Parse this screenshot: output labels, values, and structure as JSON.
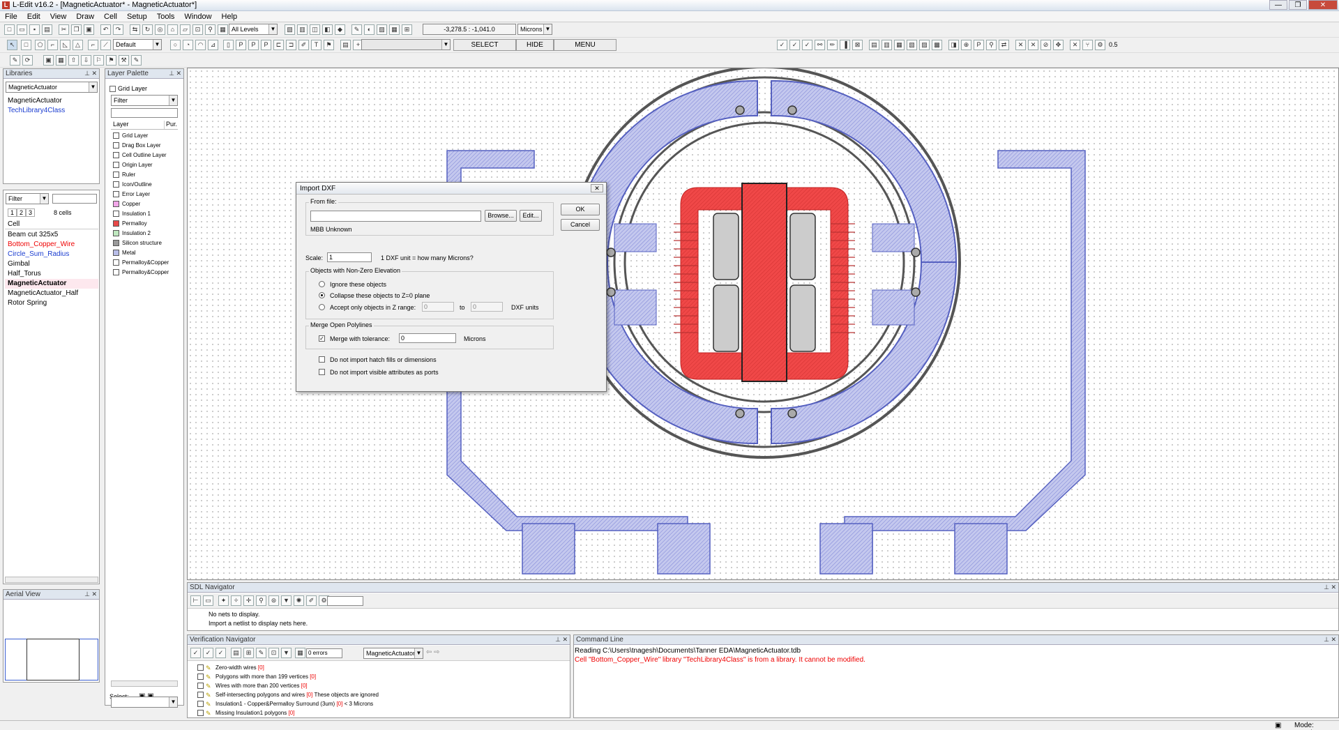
{
  "window": {
    "title": "L-Edit v16.2 - [MagneticActuator* - MagneticActuator*]",
    "buttons": [
      "—",
      "❐",
      "✕"
    ]
  },
  "menu": [
    "File",
    "Edit",
    "View",
    "Draw",
    "Cell",
    "Setup",
    "Tools",
    "Window",
    "Help"
  ],
  "toolbar": {
    "levels": "All Levels",
    "coords": "-3,278.5 : -1,041.0",
    "units": "Microns",
    "layer_combo": "Default",
    "select_label": "SELECT",
    "hide_label": "HIDE",
    "menu_label": "MENU",
    "zoom_value": "0.5"
  },
  "libraries": {
    "header": "Libraries",
    "selected": "MagneticActuator",
    "items": [
      "MagneticActuator",
      "TechLibrary4Class"
    ],
    "filter": "Filter",
    "tabs": [
      "1",
      "2",
      "3"
    ],
    "cell_count": "8 cells",
    "cell_header": "Cell",
    "cells": [
      "Beam cut 325x5",
      "Bottom_Copper_Wire",
      "Circle_Sum_Radius",
      "Gimbal",
      "Half_Torus",
      "MagneticActuator",
      "MagneticActuator_Half",
      "Rotor Spring"
    ]
  },
  "aerial": {
    "header": "Aerial View"
  },
  "layer_palette": {
    "header": "Layer Palette",
    "grid_layer": "Grid Layer",
    "filter": "Filter",
    "col_layer": "Layer",
    "col_pur": "Pur.",
    "layers": [
      {
        "name": "Grid Layer",
        "color": "#ffffff"
      },
      {
        "name": "Drag Box Layer",
        "color": "#ffffff"
      },
      {
        "name": "Cell Outline Layer",
        "color": "#ffffff"
      },
      {
        "name": "Origin Layer",
        "color": "#ffffff"
      },
      {
        "name": "Ruler",
        "color": "#ffffff"
      },
      {
        "name": "Icon/Outline",
        "color": "#ffffff"
      },
      {
        "name": "Error Layer",
        "color": "#ffffff"
      },
      {
        "name": "Copper",
        "color": "#f2a6e8"
      },
      {
        "name": "Insulation 1",
        "color": "#ffffff"
      },
      {
        "name": "Permalloy",
        "color": "#e84848"
      },
      {
        "name": "Insulation 2",
        "color": "#bfe8bf"
      },
      {
        "name": "Silicon structure",
        "color": "#9a9a9a"
      },
      {
        "name": "Metal",
        "color": "#b8bde8"
      },
      {
        "name": "Permalloy&Copper",
        "color": "#ffffff"
      },
      {
        "name": "Permalloy&Copper",
        "color": "#ffffff"
      }
    ],
    "select_label": "Select:"
  },
  "dialog": {
    "title": "Import DXF",
    "from_file_label": "From file:",
    "browse_label": "Browse...",
    "edit_label": "Edit...",
    "mbb_text": "MBB Unknown",
    "ok_label": "OK",
    "cancel_label": "Cancel",
    "scale_label": "Scale:",
    "scale_value": "1",
    "scale_hint": "1 DXF unit = how many Microns?",
    "elevation_group": "Objects with Non-Zero Elevation",
    "opt_ignore": "Ignore these objects",
    "opt_collapse": "Collapse these objects to Z=0 plane",
    "opt_accept": "Accept only objects in Z range:",
    "z_from": "0",
    "z_to_label": "to",
    "z_to": "0",
    "z_units": "DXF units",
    "merge_group": "Merge Open Polylines",
    "merge_label": "Merge with tolerance:",
    "merge_value": "0",
    "merge_units": "Microns",
    "no_hatch": "Do not import hatch fills or dimensions",
    "no_visible": "Do not import visible attributes as ports"
  },
  "sdl": {
    "header": "SDL Navigator",
    "line1": "No nets to display.",
    "line2": "Import a netlist to display nets here."
  },
  "verification": {
    "header": "Verification Navigator",
    "errors": "0 errors",
    "cell": "MagneticActuator",
    "rows": [
      {
        "text": "Zero-width wires",
        "count": "[0]",
        "extra": ""
      },
      {
        "text": "Polygons with more than 199 vertices",
        "count": "[0]",
        "extra": ""
      },
      {
        "text": "Wires with more than 200 vertices",
        "count": "[0]",
        "extra": ""
      },
      {
        "text": "Self-intersecting polygons and wires",
        "count": "[0]",
        "extra": "These objects are ignored"
      },
      {
        "text": "Insulation1 - Copper&Permalloy Surround (3um)",
        "count": "[0]",
        "extra": "< 3 Microns"
      },
      {
        "text": "Missing Insulation1 polygons",
        "count": "[0]",
        "extra": ""
      }
    ]
  },
  "command": {
    "header": "Command Line",
    "line1": "Reading C:\\Users\\tnagesh\\Documents\\Tanner EDA\\MagneticActuator.tdb",
    "line2": "Cell \"Bottom_Copper_Wire\" library \"TechLibrary4Class\" is from a library.  It cannot be modified."
  },
  "status": {
    "mode": "Mode: Drawing"
  },
  "colors": {
    "metal": "#b8bde8",
    "metal_stroke": "#5560c0",
    "permalloy": "#f04848",
    "wire": "#555555"
  }
}
